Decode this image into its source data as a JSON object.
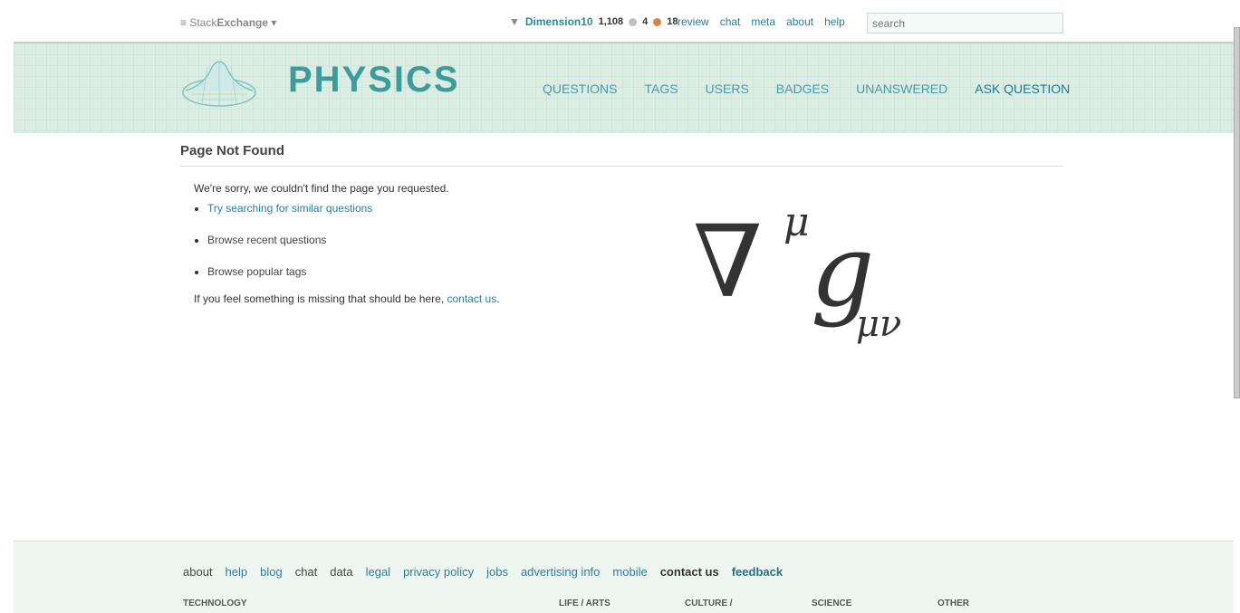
{
  "topbar": {
    "network": "Stack",
    "network_bold": "Exchange",
    "username": "Dimension10",
    "reputation": "1,108",
    "silver": "4",
    "bronze": "18",
    "links": [
      "review",
      "chat",
      "meta",
      "about",
      "help"
    ],
    "search_placeholder": "search"
  },
  "header": {
    "logo": "PHYSICS",
    "nav": [
      "QUESTIONS",
      "TAGS",
      "USERS",
      "BADGES",
      "UNANSWERED",
      "ASK QUESTION"
    ]
  },
  "main": {
    "title": "Page Not Found",
    "sorry": "We're sorry, we couldn't find the page you requested.",
    "items": [
      "Try searching for similar questions",
      "Browse recent questions",
      "Browse popular tags"
    ],
    "missing": "If you feel something is missing that should be here,",
    "contact": "contact us",
    "period": "."
  },
  "formula": {
    "nabla": "∇",
    "sup": "μ",
    "g": "g",
    "sub": "μν"
  },
  "footer": {
    "links": [
      "about",
      "help",
      "blog",
      "chat",
      "data",
      "legal",
      "privacy policy",
      "jobs",
      "advertising info",
      "mobile",
      "contact us",
      "feedback"
    ],
    "categories": [
      "TECHNOLOGY",
      "LIFE / ARTS",
      "CULTURE /",
      "SCIENCE",
      "OTHER"
    ]
  },
  "colors": {
    "accent": "#3c9b9b",
    "link": "#2a7fa0",
    "silver": "#c0c0c0",
    "bronze": "#d9824d"
  }
}
